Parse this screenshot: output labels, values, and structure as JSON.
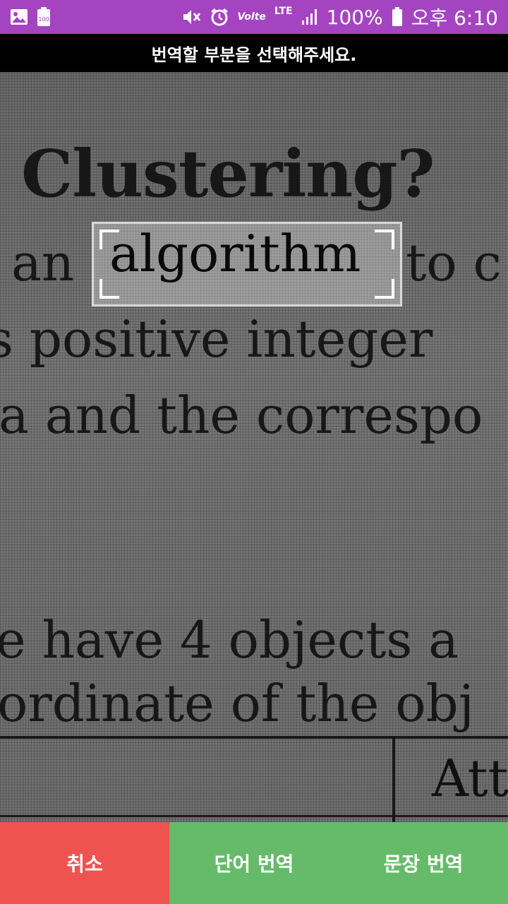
{
  "status_bar": {
    "battery_percent": "100%",
    "time": "오후 6:10",
    "lte_label": "LTE",
    "volte_label": "Volte",
    "notif_battery_label": "100"
  },
  "instruction": "번역할 부분을 선택해주세요.",
  "document": {
    "title": "Clustering?",
    "line1_left": "an",
    "line1_right": "to c",
    "line2": "s positive integer",
    "line3": "a and the correspo",
    "line4": "e have 4 objects a",
    "line5": "ordinate of the obj",
    "table_header": "Att"
  },
  "selection": {
    "word": "algorithm"
  },
  "buttons": {
    "cancel": "취소",
    "word_translate": "단어 번역",
    "sentence_translate": "문장 번역"
  },
  "colors": {
    "status_bar": "#a444c0",
    "cancel": "#ef5350",
    "translate": "#66bb6a"
  }
}
